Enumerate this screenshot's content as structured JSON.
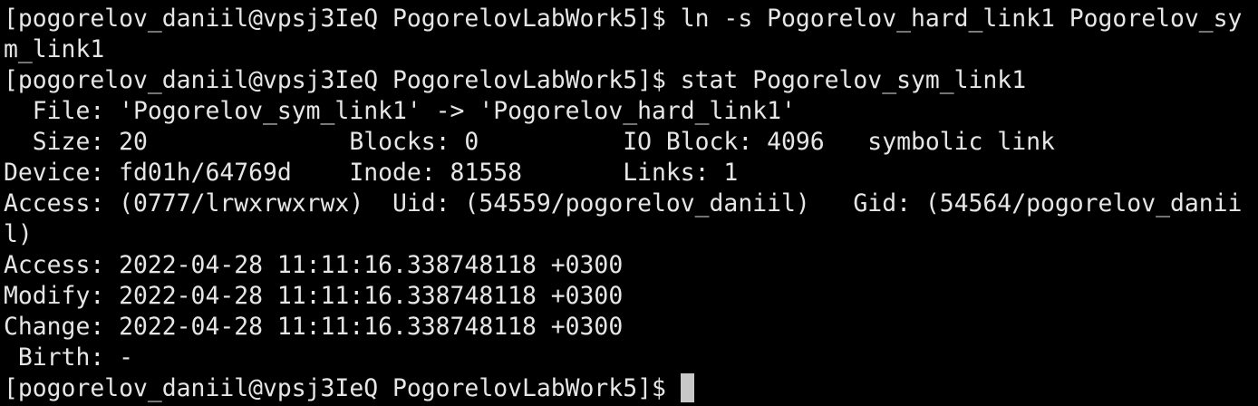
{
  "terminal": {
    "colors": {
      "background": "#000000",
      "foreground": "#e6e6e6",
      "cursor": "#c8c8c8"
    },
    "lines": [
      "[pogorelov_daniil@vpsj3IeQ PogorelovLabWork5]$ ln -s Pogorelov_hard_link1 Pogorelov_sy",
      "m_link1",
      "[pogorelov_daniil@vpsj3IeQ PogorelovLabWork5]$ stat Pogorelov_sym_link1",
      "  File: 'Pogorelov_sym_link1' -> 'Pogorelov_hard_link1'",
      "  Size: 20              Blocks: 0          IO Block: 4096   symbolic link",
      "Device: fd01h/64769d    Inode: 81558       Links: 1",
      "Access: (0777/lrwxrwxrwx)  Uid: (54559/pogorelov_daniil)   Gid: (54564/pogorelov_danii",
      "l)",
      "Access: 2022-04-28 11:11:16.338748118 +0300",
      "Modify: 2022-04-28 11:11:16.338748118 +0300",
      "Change: 2022-04-28 11:11:16.338748118 +0300",
      " Birth: -"
    ],
    "prompt": "[pogorelov_daniil@vpsj3IeQ PogorelovLabWork5]$ "
  }
}
